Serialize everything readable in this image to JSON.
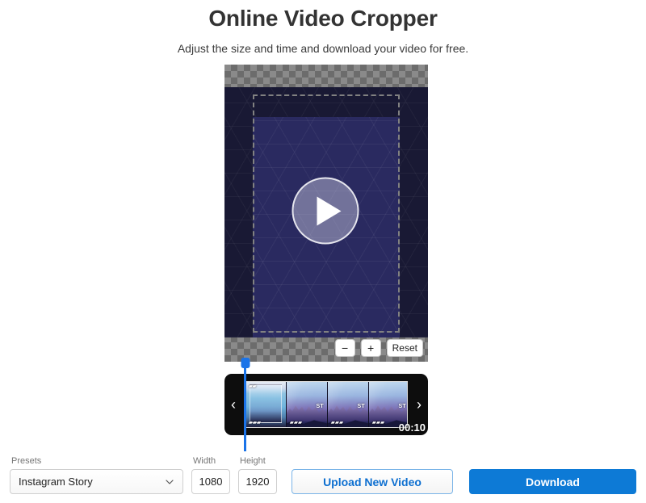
{
  "header": {
    "title": "Online Video Cropper",
    "subtitle": "Adjust the size and time and download your video for free."
  },
  "editor": {
    "play_button_label": "Play",
    "controls": {
      "zoom_out_label": "−",
      "zoom_in_label": "+",
      "reset_label": "Reset"
    },
    "crop": {
      "preset_name": "Instagram Story",
      "width": "1080",
      "height": "1920"
    }
  },
  "timeline": {
    "prev_label": "‹",
    "next_label": "›",
    "duration": "00:10",
    "frames": [
      {
        "badge": "",
        "corner": ""
      },
      {
        "badge": "ST",
        "corner": ""
      },
      {
        "badge": "ST",
        "corner": ""
      },
      {
        "badge": "ST",
        "corner": ""
      }
    ],
    "tail_dots": "●●●"
  },
  "bottom_bar": {
    "presets_label": "Presets",
    "presets_value": "Instagram Story",
    "width_label": "Width",
    "width_value": "1080",
    "height_label": "Height",
    "height_value": "1920",
    "upload_label": "Upload New Video",
    "download_label": "Download"
  },
  "colors": {
    "accent_blue": "#0d7ad6",
    "playhead_blue": "#1a73e8",
    "video_crop_navy": "#2a2a60",
    "video_outside_navy": "#191934",
    "title_gray": "#333333"
  }
}
